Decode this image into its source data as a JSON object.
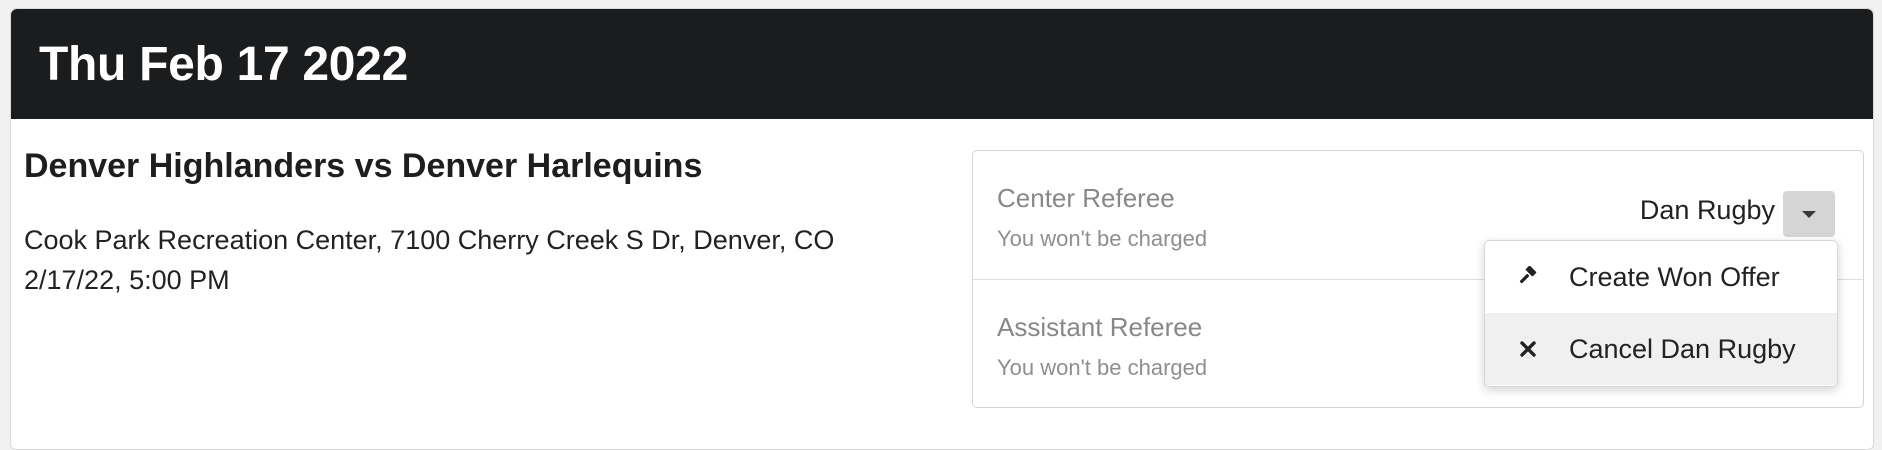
{
  "header": {
    "date": "Thu Feb 17 2022"
  },
  "game": {
    "title": "Denver Highlanders vs Denver Harlequins",
    "location": "Cook Park Recreation Center, 7100 Cherry Creek S Dr, Denver, CO",
    "datetime": "2/17/22, 5:00 PM"
  },
  "referees": [
    {
      "role": "Center Referee",
      "note": "You won't be charged",
      "assignee": "Dan Rugby"
    },
    {
      "role": "Assistant Referee",
      "note": "You won't be charged"
    }
  ],
  "dropdown": {
    "items": [
      {
        "label": "Create Won Offer",
        "icon": "gavel-icon"
      },
      {
        "label": "Cancel Dan Rugby",
        "icon": "close-icon"
      }
    ]
  },
  "colors": {
    "header_bg": "#1b1c1d",
    "toggle_bg": "#d5d5d5",
    "muted_text": "#888888"
  }
}
